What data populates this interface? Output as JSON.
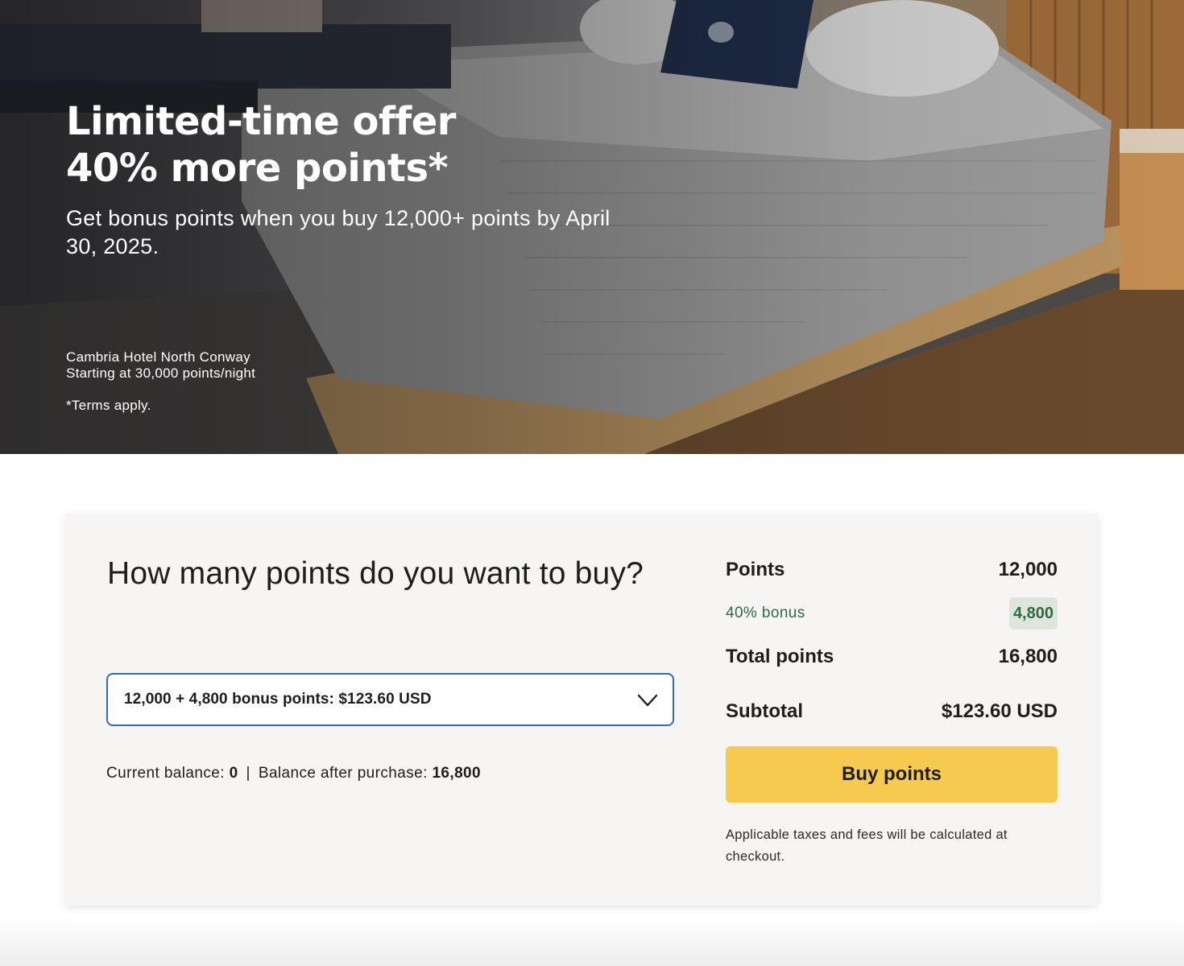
{
  "hero": {
    "title_line1": "Limited-time offer",
    "title_line2": "40% more points*",
    "subtitle": "Get bonus points when you buy 12,000+ points by April 30, 2025.",
    "hotel_name": "Cambria Hotel North Conway",
    "hotel_rate": "Starting at 30,000 points/night",
    "terms": "*Terms apply."
  },
  "purchase": {
    "question": "How many points do you want to buy?",
    "select": {
      "value": "12,000 + 4,800 bonus points: $123.60 USD",
      "icon": "chevron-down-icon"
    },
    "balance": {
      "current_label": "Current balance:",
      "current_value": "0",
      "separator": "|",
      "after_label": "Balance after purchase:",
      "after_value": "16,800"
    }
  },
  "summary": {
    "points_label": "Points",
    "points_value": "12,000",
    "bonus_label": "40% bonus",
    "bonus_value": "4,800",
    "total_label": "Total points",
    "total_value": "16,800",
    "subtotal_label": "Subtotal",
    "subtotal_value": "$123.60 USD",
    "buy_label": "Buy points",
    "fineprint": "Applicable taxes and fees will be calculated at checkout."
  },
  "colors": {
    "buy_button": "#f6c94f",
    "select_border": "#3a67b4",
    "bonus_text": "#2f6b45",
    "bonus_badge": "#dde5dd",
    "card_background": "#f6f5f4"
  }
}
